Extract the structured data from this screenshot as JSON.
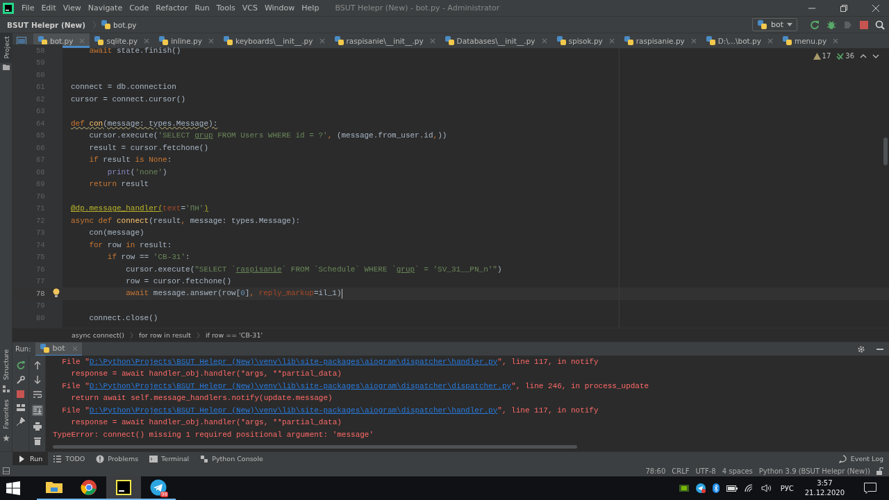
{
  "window": {
    "title": "BSUT Helepr (New) - bot.py - Administrator"
  },
  "menu": [
    "File",
    "Edit",
    "View",
    "Navigate",
    "Code",
    "Refactor",
    "Run",
    "Tools",
    "VCS",
    "Window",
    "Help"
  ],
  "navbar": {
    "project": "BSUT Helepr (New)",
    "file": "bot.py",
    "run_config": "bot"
  },
  "side_tools": {
    "top": [
      {
        "label": "Project",
        "selected": true
      }
    ],
    "bottom": [
      {
        "label": "Structure",
        "selected": false
      },
      {
        "label": "Favorites",
        "selected": false
      }
    ]
  },
  "tabs": [
    {
      "label": "bot.py",
      "selected": true
    },
    {
      "label": "sqlite.py",
      "selected": false
    },
    {
      "label": "inline.py",
      "selected": false
    },
    {
      "label": "keyboards\\__init__.py",
      "selected": false
    },
    {
      "label": "raspisanie\\__init__.py",
      "selected": false
    },
    {
      "label": "Databases\\__init__.py",
      "selected": false
    },
    {
      "label": "spisok.py",
      "selected": false
    },
    {
      "label": "raspisanie.py",
      "selected": false
    },
    {
      "label": "D:\\...\\bot.py",
      "selected": false
    },
    {
      "label": "menu.py",
      "selected": false
    }
  ],
  "inspections": {
    "warnings": "17",
    "weak_warnings": "36"
  },
  "code_lines": [
    {
      "number": "58",
      "current": false,
      "tokens": [
        {
          "kind": "kw",
          "text": "    await"
        },
        {
          "kind": "plain",
          "text": " state.finish()"
        }
      ]
    },
    {
      "number": "59",
      "current": false
    },
    {
      "number": "60",
      "current": false
    },
    {
      "number": "61",
      "current": false,
      "tokens": [
        {
          "kind": "plain",
          "text": "connect = db.connection"
        }
      ]
    },
    {
      "number": "62",
      "current": false,
      "tokens": [
        {
          "kind": "plain",
          "text": "cursor = connect.cursor()"
        }
      ]
    },
    {
      "number": "63",
      "current": false
    },
    {
      "number": "64",
      "current": false,
      "tokens": [
        {
          "kind": "warnkw",
          "text": "def "
        },
        {
          "kind": "warnfn",
          "text": "con"
        },
        {
          "kind": "warn",
          "text": "(message: types.Message):"
        }
      ]
    },
    {
      "number": "65",
      "current": false,
      "tokens": [
        {
          "kind": "plain",
          "text": "    cursor.execute("
        },
        {
          "kind": "str",
          "text": "'SELECT "
        },
        {
          "kind": "sqlid",
          "text": "grup"
        },
        {
          "kind": "str",
          "text": " FROM Users WHERE id = ?'"
        },
        {
          "kind": "kw",
          "text": ","
        },
        {
          "kind": "plain",
          "text": " (message.from_user.id"
        },
        {
          "kind": "kw",
          "text": ","
        },
        {
          "kind": "plain",
          "text": "))"
        }
      ]
    },
    {
      "number": "66",
      "current": false,
      "tokens": [
        {
          "kind": "plain",
          "text": "    result = cursor.fetchone()"
        }
      ]
    },
    {
      "number": "67",
      "current": false,
      "tokens": [
        {
          "kind": "kw",
          "text": "    if"
        },
        {
          "kind": "plain",
          "text": " result "
        },
        {
          "kind": "kw",
          "text": "is None"
        },
        {
          "kind": "plain",
          "text": ":"
        }
      ]
    },
    {
      "number": "68",
      "current": false,
      "tokens": [
        {
          "kind": "builtin",
          "text": "        print"
        },
        {
          "kind": "plain",
          "text": "("
        },
        {
          "kind": "str",
          "text": "'none'"
        },
        {
          "kind": "plain",
          "text": ")"
        }
      ]
    },
    {
      "number": "69",
      "current": false,
      "tokens": [
        {
          "kind": "kw",
          "text": "    return"
        },
        {
          "kind": "plain",
          "text": " result"
        }
      ]
    },
    {
      "number": "70",
      "current": false
    },
    {
      "number": "71",
      "current": false,
      "tokens": [
        {
          "kind": "deco",
          "text": "@dp.message_handler("
        },
        {
          "kind": "param",
          "text": "text"
        },
        {
          "kind": "plain",
          "text": "="
        },
        {
          "kind": "str",
          "text": "'ПН'"
        },
        {
          "kind": "deco",
          "text": ")"
        }
      ]
    },
    {
      "number": "72",
      "current": false,
      "tokens": [
        {
          "kind": "kw",
          "text": "async def "
        },
        {
          "kind": "fn",
          "text": "connect"
        },
        {
          "kind": "plain",
          "text": "(result"
        },
        {
          "kind": "kw",
          "text": ","
        },
        {
          "kind": "plain",
          "text": " message: types.Message):"
        }
      ]
    },
    {
      "number": "73",
      "current": false,
      "tokens": [
        {
          "kind": "plain",
          "text": "    con(message)"
        }
      ]
    },
    {
      "number": "74",
      "current": false,
      "tokens": [
        {
          "kind": "kw",
          "text": "    for"
        },
        {
          "kind": "plain",
          "text": " row "
        },
        {
          "kind": "kw",
          "text": "in"
        },
        {
          "kind": "plain",
          "text": " result:"
        }
      ]
    },
    {
      "number": "75",
      "current": false,
      "tokens": [
        {
          "kind": "kw",
          "text": "        if"
        },
        {
          "kind": "plain",
          "text": " row == "
        },
        {
          "kind": "str",
          "text": "'CB-31'"
        },
        {
          "kind": "plain",
          "text": ":"
        }
      ]
    },
    {
      "number": "76",
      "current": false,
      "tokens": [
        {
          "kind": "plain",
          "text": "            cursor.execute("
        },
        {
          "kind": "str",
          "text": "\"SELECT `"
        },
        {
          "kind": "sqlid",
          "text": "raspisanie"
        },
        {
          "kind": "str",
          "text": "` FROM `Schedule` WHERE `"
        },
        {
          "kind": "sqlid",
          "text": "grup"
        },
        {
          "kind": "str",
          "text": "` = 'SV_31__PN_n'\""
        },
        {
          "kind": "plain",
          "text": ")"
        }
      ]
    },
    {
      "number": "77",
      "current": false,
      "tokens": [
        {
          "kind": "plain",
          "text": "            row = cursor.fetchone()"
        }
      ]
    },
    {
      "number": "78",
      "current": true,
      "tokens": [
        {
          "kind": "kw",
          "text": "            await"
        },
        {
          "kind": "plain",
          "text": " message.answer(row["
        },
        {
          "kind": "num",
          "text": "0"
        },
        {
          "kind": "plain",
          "text": "]"
        },
        {
          "kind": "kw",
          "text": ", "
        },
        {
          "kind": "param",
          "text": "reply_markup"
        },
        {
          "kind": "plain",
          "text": "=il_1)"
        }
      ]
    },
    {
      "number": "79",
      "current": false
    },
    {
      "number": "80",
      "current": false,
      "tokens": [
        {
          "kind": "plain",
          "text": "    connect.close()"
        }
      ]
    }
  ],
  "breadcrumb": [
    "async connect()",
    "for row in result",
    "if row == 'CB-31'"
  ],
  "run_panel": {
    "label": "Run:",
    "tab": "bot",
    "console": [
      {
        "kind": "file",
        "before": "  File \"",
        "link": "D:\\Python\\Projects\\BSUT Helepr (New)\\venv\\lib\\site-packages\\aiogram\\dispatcher\\handler.py",
        "after": "\", line 117, in notify"
      },
      {
        "kind": "code",
        "text": "    response = await handler_obj.handler(*args, **partial_data)"
      },
      {
        "kind": "file",
        "before": "  File \"",
        "link": "D:\\Python\\Projects\\BSUT Helepr (New)\\venv\\lib\\site-packages\\aiogram\\dispatcher\\dispatcher.py",
        "after": "\", line 246, in process_update"
      },
      {
        "kind": "code",
        "text": "    return await self.message_handlers.notify(update.message)"
      },
      {
        "kind": "file",
        "before": "  File \"",
        "link": "D:\\Python\\Projects\\BSUT Helepr (New)\\venv\\lib\\site-packages\\aiogram\\dispatcher\\handler.py",
        "after": "\", line 117, in notify"
      },
      {
        "kind": "code",
        "text": "    response = await handler_obj.handler(*args, **partial_data)"
      },
      {
        "kind": "code",
        "text": "TypeError: connect() missing 1 required positional argument: 'message'"
      }
    ]
  },
  "tool_tabs": [
    {
      "label": "Run",
      "selected": true
    },
    {
      "label": "TODO",
      "selected": false
    },
    {
      "label": "Problems",
      "selected": false
    },
    {
      "label": "Terminal",
      "selected": false
    },
    {
      "label": "Python Console",
      "selected": false
    }
  ],
  "event_log": "Event Log",
  "status_bar": [
    "78:60",
    "CRLF",
    "UTF-8",
    "4 spaces",
    "Python 3.9 (BSUT Helepr (New))"
  ],
  "taskbar": {
    "telegram_badge": "98",
    "language": "РУС",
    "time": "3:57",
    "date": "21.12.2020"
  }
}
